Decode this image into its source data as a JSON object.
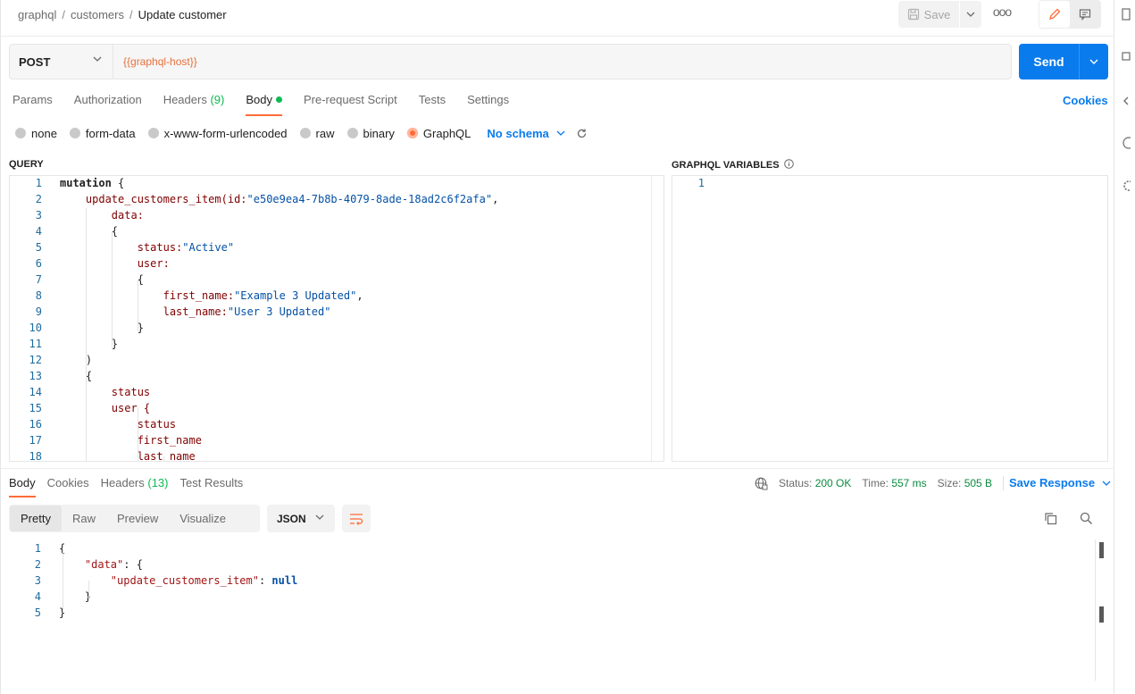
{
  "header": {
    "breadcrumb": [
      "graphql",
      "customers",
      "Update customer"
    ],
    "save_label": "Save",
    "more_label": "ooo"
  },
  "request": {
    "method": "POST",
    "url": "{{graphql-host}}",
    "send_label": "Send",
    "tabs": [
      {
        "label": "Params"
      },
      {
        "label": "Authorization"
      },
      {
        "label": "Headers",
        "count": "(9)"
      },
      {
        "label": "Body"
      },
      {
        "label": "Pre-request Script"
      },
      {
        "label": "Tests"
      },
      {
        "label": "Settings"
      }
    ],
    "cookies_label": "Cookies",
    "body_types": [
      "none",
      "form-data",
      "x-www-form-urlencoded",
      "raw",
      "binary",
      "GraphQL"
    ],
    "selected_body_type": "GraphQL",
    "schema_label": "No schema"
  },
  "query": {
    "label": "QUERY",
    "line_numbers": [
      "1",
      "2",
      "3",
      "4",
      "5",
      "6",
      "7",
      "8",
      "9",
      "10",
      "11",
      "12",
      "13",
      "14",
      "15",
      "16",
      "17",
      "18"
    ],
    "lines": [
      [
        {
          "t": "mutation",
          "c": "kw"
        },
        {
          "t": " {",
          "c": "punc"
        }
      ],
      [
        {
          "t": "    update_customers_item(id:",
          "c": "plain"
        },
        {
          "t": "\"e50e9ea4-7b8b-4079-8ade-18ad2c6f2afa\"",
          "c": "str"
        },
        {
          "t": ",",
          "c": "punc"
        }
      ],
      [
        {
          "t": "        data:",
          "c": "plain"
        }
      ],
      [
        {
          "t": "        {",
          "c": "punc"
        }
      ],
      [
        {
          "t": "            status:",
          "c": "plain"
        },
        {
          "t": "\"Active\"",
          "c": "str"
        }
      ],
      [
        {
          "t": "            user:",
          "c": "plain"
        }
      ],
      [
        {
          "t": "            {",
          "c": "punc"
        }
      ],
      [
        {
          "t": "                first_name:",
          "c": "plain"
        },
        {
          "t": "\"Example 3 Updated\"",
          "c": "str"
        },
        {
          "t": ",",
          "c": "punc"
        }
      ],
      [
        {
          "t": "                last_name:",
          "c": "plain"
        },
        {
          "t": "\"User 3 Updated\"",
          "c": "str"
        }
      ],
      [
        {
          "t": "            }",
          "c": "punc"
        }
      ],
      [
        {
          "t": "        }",
          "c": "punc"
        }
      ],
      [
        {
          "t": "    )",
          "c": "punc"
        }
      ],
      [
        {
          "t": "    {",
          "c": "punc"
        }
      ],
      [
        {
          "t": "        status",
          "c": "plain"
        }
      ],
      [
        {
          "t": "        user {",
          "c": "plain"
        }
      ],
      [
        {
          "t": "            status",
          "c": "plain"
        }
      ],
      [
        {
          "t": "            first_name",
          "c": "plain"
        }
      ],
      [
        {
          "t": "            last_name",
          "c": "plain"
        }
      ]
    ]
  },
  "variables": {
    "label": "GRAPHQL VARIABLES",
    "line_numbers": [
      "1"
    ]
  },
  "response": {
    "tabs": [
      {
        "label": "Body"
      },
      {
        "label": "Cookies"
      },
      {
        "label": "Headers",
        "count": "(13)"
      },
      {
        "label": "Test Results"
      }
    ],
    "status_label": "Status:",
    "status_value": "200 OK",
    "time_label": "Time:",
    "time_value": "557 ms",
    "size_label": "Size:",
    "size_value": "505 B",
    "save_response_label": "Save Response",
    "views": [
      "Pretty",
      "Raw",
      "Preview",
      "Visualize"
    ],
    "format": "JSON",
    "line_numbers": [
      "1",
      "2",
      "3",
      "4",
      "5"
    ],
    "lines": [
      [
        {
          "t": "{",
          "c": "punc"
        }
      ],
      [
        {
          "t": "    ",
          "c": "punc"
        },
        {
          "t": "\"data\"",
          "c": "rkey"
        },
        {
          "t": ": {",
          "c": "punc"
        }
      ],
      [
        {
          "t": "        ",
          "c": "punc"
        },
        {
          "t": "\"update_customers_item\"",
          "c": "rkey"
        },
        {
          "t": ": ",
          "c": "punc"
        },
        {
          "t": "null",
          "c": "rnull"
        }
      ],
      [
        {
          "t": "    }",
          "c": "punc"
        }
      ],
      [
        {
          "t": "}",
          "c": "punc"
        }
      ]
    ]
  },
  "colors": {
    "accent": "#ff6c37",
    "primary": "#097bed",
    "success": "#0cbb52"
  }
}
